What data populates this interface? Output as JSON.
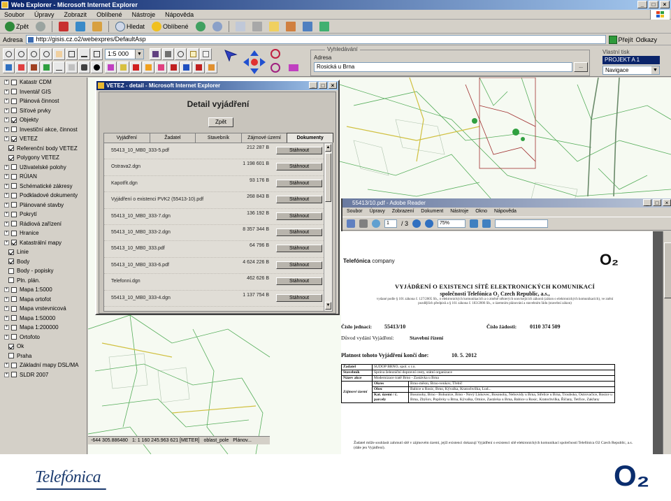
{
  "browser": {
    "title": "Web Explorer - Microsoft Internet Explorer",
    "menu": [
      "Soubor",
      "Úpravy",
      "Zobrazit",
      "Oblíbené",
      "Nástroje",
      "Nápověda"
    ],
    "toolbar": {
      "back": "Zpět",
      "search": "Hledat",
      "favorites": "Oblíbené"
    },
    "address_label": "Adresa",
    "address_value": "http://gisis.cz.o2/webexpres/DefaultAsp",
    "go_label": "Přejít",
    "links_label": "Odkazy"
  },
  "gis": {
    "scale_combo": "1:5 000",
    "search": {
      "legend": "Vyhledávání",
      "label": "Adresa",
      "value": "Rosická u Brna",
      "button": "..."
    },
    "right_panel": {
      "legend": "Vlastní tisk",
      "project": "PROJEKT A 1",
      "mode": "Navigace"
    }
  },
  "layers": [
    {
      "label": "Katastr CDM",
      "checked": false,
      "child": false
    },
    {
      "label": "Inventář GIS",
      "checked": false,
      "child": false
    },
    {
      "label": "Plánová činnost",
      "checked": false,
      "child": false
    },
    {
      "label": "Síťové prvky",
      "checked": false,
      "child": false
    },
    {
      "label": "Objekty",
      "checked": true,
      "child": false
    },
    {
      "label": "Investiční akce, činnost",
      "checked": false,
      "child": false
    },
    {
      "label": "VETEZ",
      "checked": true,
      "child": false
    },
    {
      "label": "Referenční body VETEZ",
      "checked": true,
      "child": true
    },
    {
      "label": "Polygony VETEZ",
      "checked": true,
      "child": true
    },
    {
      "label": "Uživatelské polohy",
      "checked": false,
      "child": false
    },
    {
      "label": "RÚIAN",
      "checked": false,
      "child": false
    },
    {
      "label": "Schématické zákresy",
      "checked": false,
      "child": false
    },
    {
      "label": "Podkladové dokumenty",
      "checked": false,
      "child": false
    },
    {
      "label": "Plánované stavby",
      "checked": false,
      "child": false
    },
    {
      "label": "Pokrytí",
      "checked": false,
      "child": false
    },
    {
      "label": "Rádiová zařízení",
      "checked": false,
      "child": false
    },
    {
      "label": "Hranice",
      "checked": false,
      "child": false
    },
    {
      "label": "Katastrální mapy",
      "checked": true,
      "child": false
    },
    {
      "label": "Linie",
      "checked": true,
      "child": true
    },
    {
      "label": "Body",
      "checked": true,
      "child": true
    },
    {
      "label": "Body - popisky",
      "checked": false,
      "child": true
    },
    {
      "label": "Pln. plán.",
      "checked": false,
      "child": true
    },
    {
      "label": "Mapa 1:5000",
      "checked": false,
      "child": false
    },
    {
      "label": "Mapa ortofot",
      "checked": false,
      "child": false
    },
    {
      "label": "Mapa vrstevnicová",
      "checked": false,
      "child": false
    },
    {
      "label": "Mapa 1:50000",
      "checked": false,
      "child": false
    },
    {
      "label": "Mapa 1:200000",
      "checked": false,
      "child": false
    },
    {
      "label": "Ortofoto",
      "checked": false,
      "child": false
    },
    {
      "label": "Ok",
      "checked": true,
      "child": true
    },
    {
      "label": "Praha",
      "checked": false,
      "child": true
    },
    {
      "label": "Základní mapy DSL/MA",
      "checked": false,
      "child": false
    },
    {
      "label": "SLDR 2007",
      "checked": false,
      "child": false
    }
  ],
  "status": [
    "-644 305.886480",
    "1: 1 160 245.963 621 [METER]",
    "oblast_pole",
    "Plánov..."
  ],
  "detail": {
    "window_title": "VETEZ - detail - Microsoft Internet Explorer",
    "heading": "Detail vyjádření",
    "back_button": "Zpět",
    "tabs": [
      "Vyjádření",
      "Žadatel",
      "Stavebník",
      "Zájmové území",
      "Dokumenty"
    ],
    "active_tab": "Dokumenty",
    "download_label": "Stáhnout",
    "documents": [
      {
        "name": "55413_10_MB0_333-5.pdf",
        "size": "212 287 B"
      },
      {
        "name": "Ostrava2.dgn",
        "size": "1 198 601 B"
      },
      {
        "name": "Kapotřit.dgn",
        "size": "93 176 B"
      },
      {
        "name": "Vyjádření o existenci PVK2 (55413-10).pdf",
        "size": "268 843 B"
      },
      {
        "name": "55413_10_MB0_333-7.dgn",
        "size": "136 192 B"
      },
      {
        "name": "55413_10_MB0_333-2.dgn",
        "size": "8 357 344 B"
      },
      {
        "name": "55413_10_MB0_333.pdf",
        "size": "64 796 B"
      },
      {
        "name": "55413_10_MB0_333-6.pdf",
        "size": "4 624 226 B"
      },
      {
        "name": "Telefonni.dgn",
        "size": "462 626 B"
      },
      {
        "name": "55413_10_MB0_333-4.dgn",
        "size": "1 137 754 B"
      }
    ]
  },
  "reader": {
    "title": "55413/10.pdf - Adobe Reader",
    "menu": [
      "Soubor",
      "Úpravy",
      "Zobrazení",
      "Dokument",
      "Nástroje",
      "Okno",
      "Nápověda"
    ],
    "page_input": "1",
    "page_total": "/ 3",
    "zoom": "75%",
    "search_placeholder": ""
  },
  "pdf": {
    "company_prefix": "Telefónica",
    "company_suffix": "company",
    "logo": "O₂",
    "heading": "VYJÁDŘENÍ O EXISTENCI SÍTĚ ELEKTRONICKÝCH KOMUNIKACÍ",
    "subheading": "společnosti Telefónica O₂ Czech Republic, a.s.,",
    "fine_print": "vydané podle § 101 zákona č. 127/2005 Sb., o elektronických komunikacích a o změně některých souvisejících zákonů (zákon o elektronických komunikacích), ve znění pozdějších předpisů a § 161 zákona č. 183/2006 Sb., o územním plánování a stavebním řádu (stavební zákon)",
    "ref_label": "Číslo jednací:",
    "ref_value": "55413/10",
    "req_label": "Číslo žádosti:",
    "req_value": "0110 374 509",
    "reason_label": "Důvod vydání Vyjádření:",
    "reason_value": "Stavební řízení",
    "valid_label": "Platnost tohoto Vyjádření končí dne:",
    "valid_value": "10. 5. 2012",
    "table": [
      [
        "Žadatel",
        "SUDOP BRNO, spol. s r.o."
      ],
      [
        "Stavebník",
        "Správa železniční dopravní cesty, státní organizace"
      ],
      [
        "Název akce",
        "Modernizace tratě Brno - Zastávka u Brna"
      ],
      [
        "Zájmové území",
        "Okres",
        "Brno-město, Brno-venkov, Třebíč"
      ],
      [
        "",
        "Obec",
        "Babice u Rosic, Brno, Kývalka, Kratochvilka, Lud..."
      ],
      [
        "",
        "Kat. území / č. parcely",
        "Bosonohy, Brno - Bohunice, Brno - Nový Lískovec, Bosonohy, Nebovidy u Brna, Střelice u Brna, Troubsko, Ostrovačice, Rosice u Brna, Zbýšov, Popůvky u Brna, Kývalka, Omice, Zastávka u Brna, Babice u Rosic, Kratochvilka, Říčany, Tetčice, Zakřany"
      ]
    ],
    "footer_text": "Žadatel může souhlasit zahrnutí sítě v zájmovém území, jejíž existenci dokazují Vyjádření o existenci sítě elektronických komunikací společnosti Telefónica O2 Czech Republic, a.s. (dále jen Vyjádření)."
  },
  "slide": {
    "left_logo": "Telefónica",
    "right_logo": "O₂"
  }
}
